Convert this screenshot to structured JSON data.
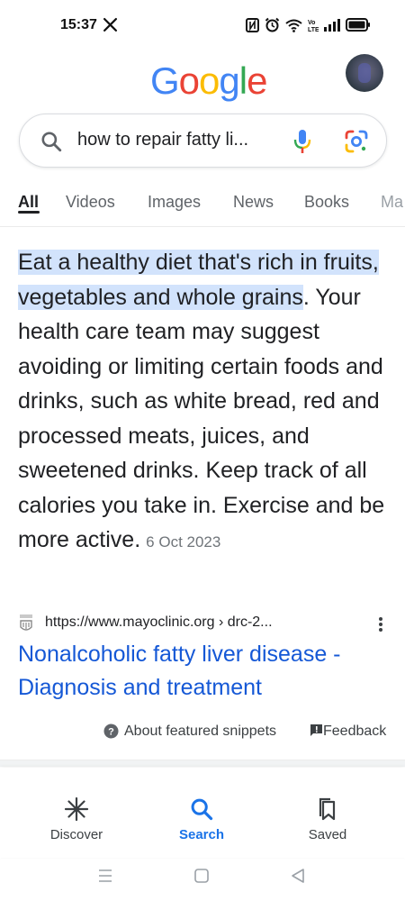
{
  "status_bar": {
    "time": "15:37",
    "icons": [
      "x-app-icon",
      "nfc-icon",
      "alarm-icon",
      "wifi-icon",
      "volte-icon",
      "signal-icon",
      "battery-icon"
    ]
  },
  "header": {
    "logo_letters": [
      {
        "char": "G",
        "color": "#4285F4"
      },
      {
        "char": "o",
        "color": "#EA4335"
      },
      {
        "char": "o",
        "color": "#FBBC05"
      },
      {
        "char": "g",
        "color": "#4285F4"
      },
      {
        "char": "l",
        "color": "#34A853"
      },
      {
        "char": "e",
        "color": "#EA4335"
      }
    ],
    "avatar": "avatar-icon"
  },
  "search": {
    "query": "how to repair fatty li..."
  },
  "tabs": [
    "All",
    "Videos",
    "Images",
    "News",
    "Books",
    "Ma"
  ],
  "active_tab": "All",
  "snippet": {
    "highlighted": "Eat a healthy diet that's rich in fruits, vegetables and whole grains",
    "body": ". Your health care team may suggest avoiding or limiting certain foods and drinks, such as white bread, red and processed meats, juices, and sweetened drinks. Keep track of all calories you take in. Exercise and be more active.",
    "date": "6 Oct 2023"
  },
  "source": {
    "url": "https://www.mayoclinic.org › drc-2...",
    "title": "Nonalcoholic fatty liver disease - Diagnosis and treatment"
  },
  "about": {
    "about_label": "About featured snippets",
    "feedback_label": "Feedback"
  },
  "bottom_nav": {
    "discover": "Discover",
    "search": "Search",
    "saved": "Saved"
  },
  "colors": {
    "link": "#1558d6",
    "highlight": "#d2e3fc",
    "active_nav": "#1a73e8"
  }
}
